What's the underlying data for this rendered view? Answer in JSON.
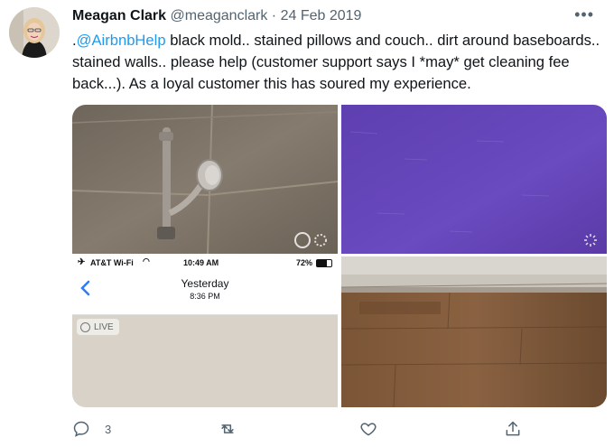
{
  "tweet": {
    "author_name": "Meagan Clark",
    "author_handle": "@meaganclark",
    "separator": "·",
    "date": "24 Feb 2019",
    "text_prefix": ".",
    "mention": "@AirbnbHelp",
    "text_body": " black mold.. stained pillows and couch.. dirt around baseboards.. stained walls.. please help (customer support says I *may* get cleaning fee back...). As a loyal customer this has soured my experience.",
    "more_label": "•••"
  },
  "phone_screenshot": {
    "carrier": "AT&T Wi-Fi",
    "time": "10:49 AM",
    "battery": "72%",
    "title": "Yesterday",
    "subtitle": "8:36 PM",
    "live_label": "LIVE"
  },
  "actions": {
    "reply_count": "3",
    "retweet_count": "",
    "like_count": ""
  },
  "icons": [
    "more-icon",
    "reply-icon",
    "retweet-icon",
    "like-icon",
    "share-icon",
    "back-chevron-icon",
    "wifi-icon",
    "airplane-icon",
    "live-photo-icon",
    "loading-spinner-icon"
  ],
  "colors": {
    "mention": "#1d9bf0",
    "muted": "#536471",
    "ios_blue": "#2f7cf6"
  }
}
